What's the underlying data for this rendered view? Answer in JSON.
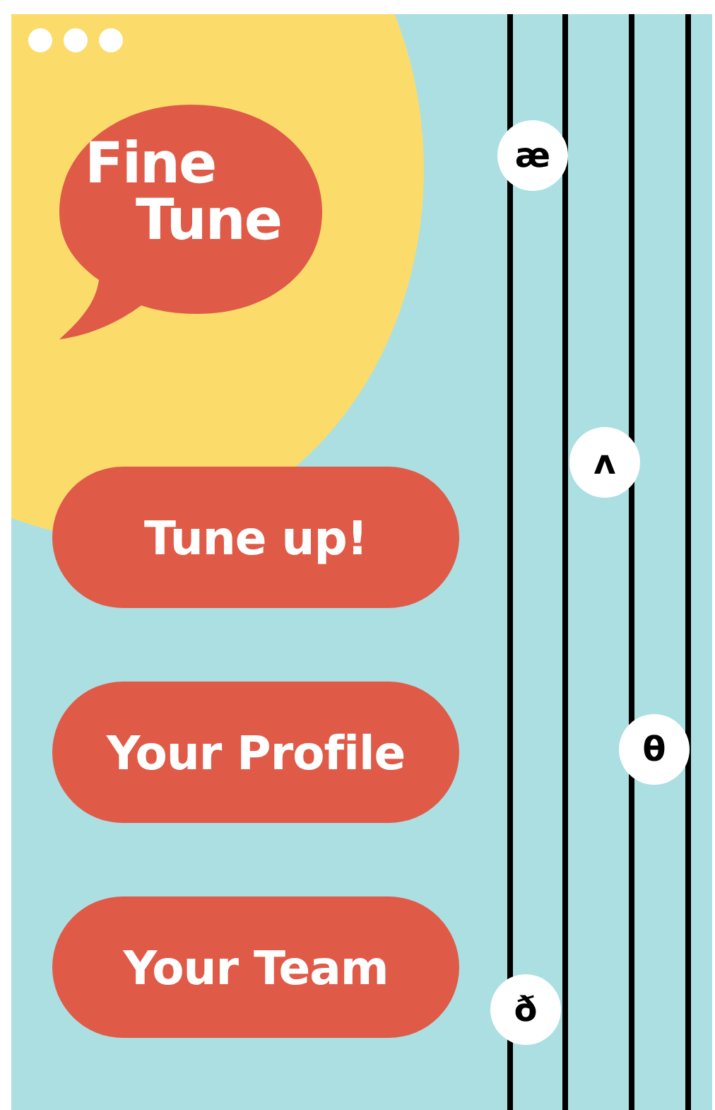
{
  "logo": {
    "lines": [
      "Fine",
      "Tune"
    ]
  },
  "buttons": [
    {
      "label": "Tune up!"
    },
    {
      "label": "Your Profile"
    },
    {
      "label": "Your Team"
    }
  ],
  "strings": [
    {
      "symbol": "æ"
    },
    {
      "symbol": "ʌ"
    },
    {
      "symbol": "θ"
    },
    {
      "symbol": "ð"
    }
  ]
}
